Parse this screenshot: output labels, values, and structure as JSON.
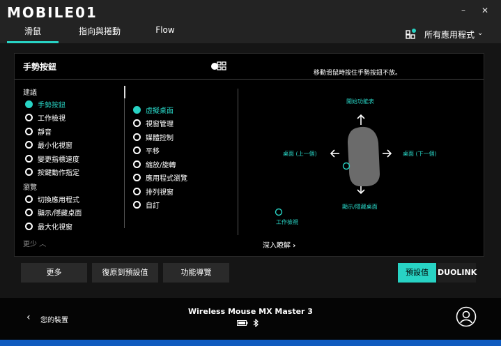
{
  "app": {
    "brand": "MOBILE01"
  },
  "window": {
    "minimize": "–",
    "close": "✕"
  },
  "tabs": [
    {
      "label": "滑鼠",
      "active": true
    },
    {
      "label": "指向與捲動",
      "active": false
    },
    {
      "label": "Flow",
      "active": false
    }
  ],
  "app_selector": {
    "label": "所有應用程式",
    "icon": "apps-grid-icon"
  },
  "panel": {
    "title": "手勢按鈕",
    "hint": "移動滑鼠時按住手勢按鈕不放。",
    "group_suggested": "建議",
    "suggested": [
      "手勢按鈕",
      "工作檢視",
      "靜音",
      "最小化視窗",
      "變更指標速度",
      "按鍵動作指定"
    ],
    "group_browse": "瀏覽",
    "browse": [
      "切換應用程式",
      "顯示/隱藏桌面",
      "最大化視窗"
    ],
    "less": "更少",
    "gestures": [
      "虛擬桌面",
      "視窗管理",
      "媒體控制",
      "平移",
      "縮放/旋轉",
      "應用程式瀏覽",
      "排列視窗",
      "自訂"
    ],
    "directions": {
      "up": "開始功能表",
      "down": "顯示/隱藏桌面",
      "left": "桌面 (上一個)",
      "right": "桌面 (下一個)",
      "click": "工作檢視"
    },
    "learn_more": "深入瞭解"
  },
  "buttons": {
    "more": "更多",
    "reset": "復原到預設值",
    "guide": "功能導覽",
    "default": "預設值",
    "duolink": "DUOLINK"
  },
  "footer": {
    "back_label": "您的裝置",
    "device": "Wireless Mouse MX Master 3"
  },
  "colors": {
    "accent": "#28d3c4",
    "background": "#151515",
    "panel": "#000000"
  }
}
